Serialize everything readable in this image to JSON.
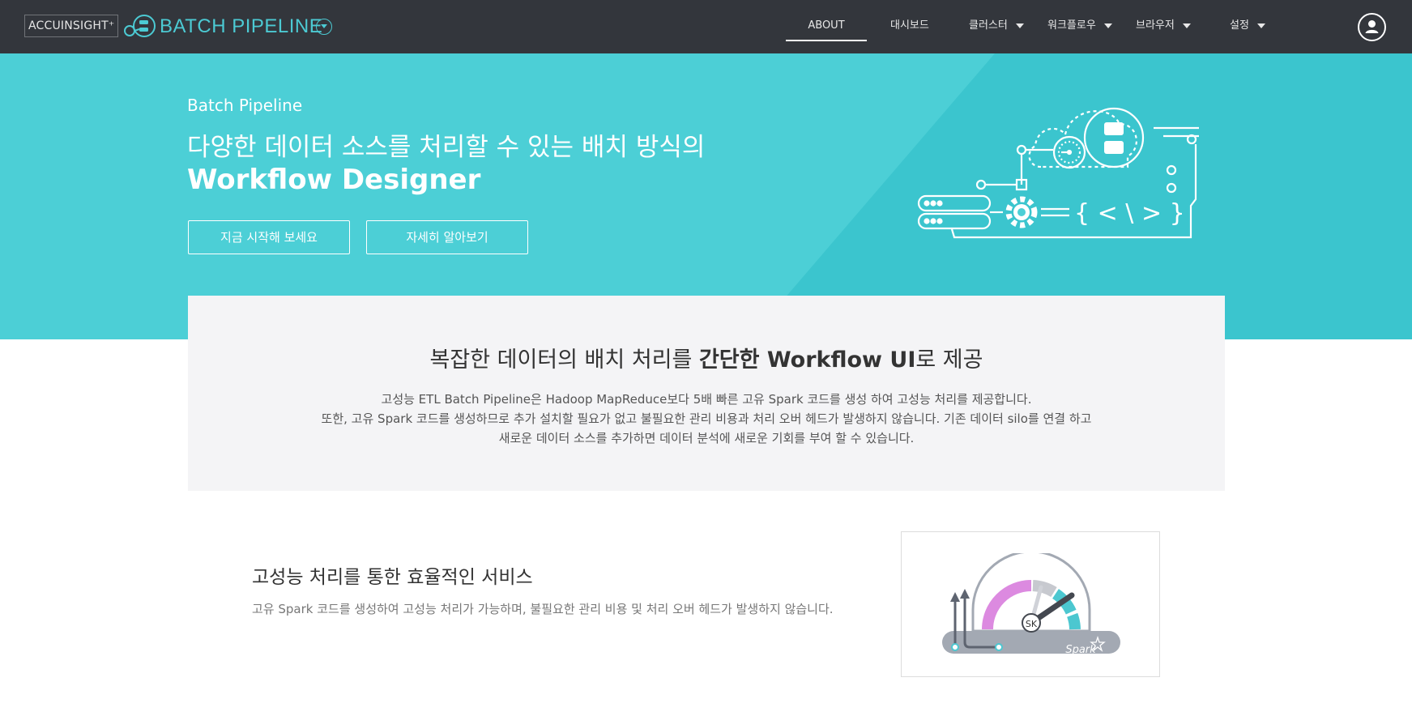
{
  "header": {
    "brand_badge": "ACCUINSIGHT⁺",
    "product_name": "BATCH PIPELINE",
    "brand_color": "#4ccad3",
    "nav": [
      {
        "label": "ABOUT",
        "active": true
      },
      {
        "label": "대시보드"
      },
      {
        "label": "클러스터",
        "has_dropdown": true
      },
      {
        "label": "워크플로우",
        "has_dropdown": true
      },
      {
        "label": "브라우저",
        "has_dropdown": true
      },
      {
        "label": "설정",
        "has_dropdown": true
      }
    ],
    "user_icon": "user-circle-icon"
  },
  "hero": {
    "eyebrow": "Batch Pipeline",
    "title": "다양한 데이터 소스를 처리할 수 있는 배치 방식의",
    "title_strong": "Workflow Designer",
    "primary_button": "지금 시작해 보세요",
    "secondary_button": "자세히 알아보기",
    "background_color": "#4ccfd6",
    "illustration": "workflow-designer-illustration",
    "code_symbol": "{ < \\ > }"
  },
  "intro": {
    "title_part1": "복잡한 데이터의 배치 처리를 ",
    "title_strong": "간단한 Workflow UI",
    "title_part2": "로 제공",
    "lines": [
      "고성능 ETL Batch Pipeline은 Hadoop MapReduce보다 5배 빠른 고유 Spark 코드를 생성 하여 고성능 처리를 제공합니다.",
      "또한, 고유 Spark 코드를 생성하므로 추가 설치할 필요가 없고 불필요한 관리 비용과 처리 오버 헤드가 발생하지 않습니다. 기존 데이터 silo를 연결 하고",
      "새로운 데이터 소스를 추가하면 데이터 분석에 새로운 기회를 부여 할 수 있습니다."
    ]
  },
  "feature": {
    "title": "고성능 처리를 통한 효율적인 서비스",
    "description": "고유 Spark 코드를 생성하여 고성능 처리가 가능하며, 불필요한 관리 비용 및 처리 오버 헤드가 발생하지 않습니다.",
    "illustration": "spark-speedometer-illustration",
    "gauge_label": "SK",
    "spark_label": "Spark"
  }
}
